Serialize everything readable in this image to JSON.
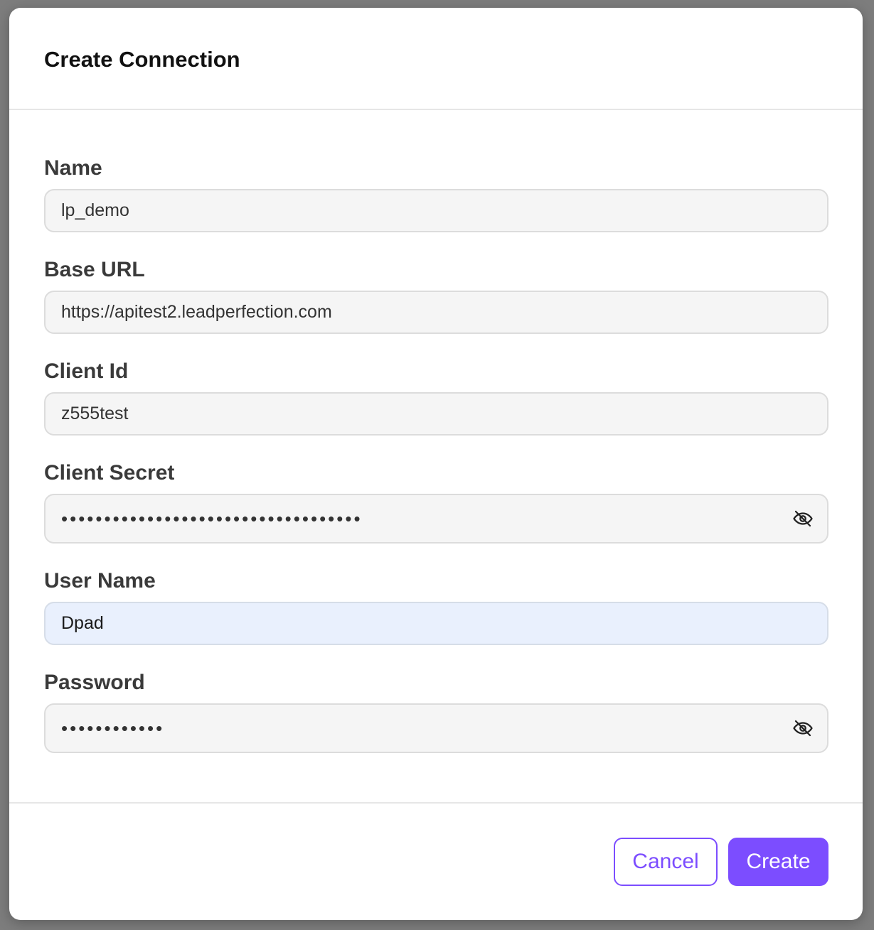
{
  "dialog": {
    "title": "Create Connection"
  },
  "fields": {
    "name": {
      "label": "Name",
      "value": "lp_demo"
    },
    "base_url": {
      "label": "Base URL",
      "value": "https://apitest2.leadperfection.com"
    },
    "client_id": {
      "label": "Client Id",
      "value": "z555test"
    },
    "client_secret": {
      "label": "Client Secret",
      "masked_value": "•••••••••••••••••••••••••••••••••••",
      "icon": "eye-off-icon"
    },
    "user_name": {
      "label": "User Name",
      "value": "Dpad"
    },
    "password": {
      "label": "Password",
      "masked_value": "••••••••••••",
      "icon": "eye-off-icon"
    }
  },
  "footer": {
    "cancel_label": "Cancel",
    "create_label": "Create"
  },
  "colors": {
    "accent": "#7c4dff",
    "focused_input_bg": "#e9f0fd",
    "input_bg": "#f5f5f5"
  }
}
